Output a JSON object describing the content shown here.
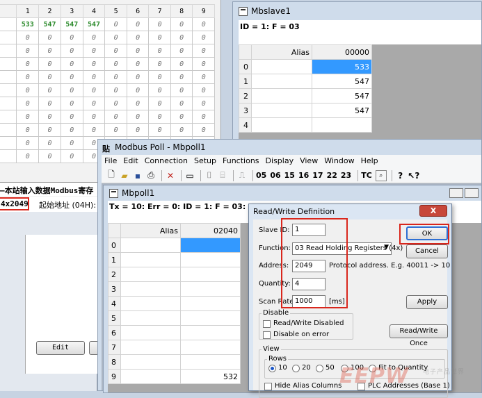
{
  "bg_grid": {
    "header": [
      "1",
      "2",
      "3",
      "4",
      "5",
      "6",
      "7",
      "8",
      "9"
    ],
    "values_row": [
      "533",
      "547",
      "547",
      "547",
      "0",
      "0",
      "0",
      "0",
      "0"
    ],
    "zero": "0",
    "title_strip": "—本站输入数据Modbus寄存",
    "address_box": "4x2049",
    "address_label": "起始地址 (04H):",
    "edit_label": "Edit"
  },
  "mbslave": {
    "title": "Mbslave1",
    "status": "ID = 1: F = 03",
    "alias_header": "Alias",
    "col_header": "00000",
    "rows": [
      {
        "n": "0",
        "value": "533"
      },
      {
        "n": "1",
        "value": "547"
      },
      {
        "n": "2",
        "value": "547"
      },
      {
        "n": "3",
        "value": "547"
      },
      {
        "n": "4",
        "value": ""
      }
    ]
  },
  "mbpoll": {
    "title": "Modbus Poll - Mbpoll1",
    "icon_text": "贴",
    "menu": [
      "File",
      "Edit",
      "Connection",
      "Setup",
      "Functions",
      "Display",
      "View",
      "Window",
      "Help"
    ],
    "toolbar_codes": [
      "05",
      "06",
      "15",
      "16",
      "17",
      "22",
      "23",
      "TC"
    ],
    "child": {
      "title": "Mbpoll1",
      "status": "Tx = 10: Err = 0: ID = 1: F = 03: SR = 1000",
      "alias_header": "Alias",
      "col_header": "02040",
      "rows": [
        "0",
        "1",
        "2",
        "3",
        "4",
        "5",
        "6",
        "7",
        "8",
        "9"
      ],
      "row9_value": "532"
    }
  },
  "dialog": {
    "title": "Read/Write Definition",
    "close": "X",
    "slave_id_label": "Slave ID:",
    "slave_id_value": "1",
    "function_label": "Function:",
    "function_value": "03 Read Holding Registers (4x)",
    "address_label": "Address:",
    "address_value": "2049",
    "address_hint": "Protocol address. E.g. 40011 -> 10",
    "quantity_label": "Quantity:",
    "quantity_value": "4",
    "scan_label": "Scan Rate:",
    "scan_value": "1000",
    "scan_unit": "[ms]",
    "ok": "OK",
    "cancel": "Cancel",
    "apply": "Apply",
    "disable_group": "Disable",
    "rw_disabled": "Read/Write Disabled",
    "disable_on_error": "Disable on error",
    "rw_once": "Read/Write Once",
    "view_group": "View",
    "rows_group": "Rows",
    "rows_options": [
      "10",
      "20",
      "50",
      "100",
      "Fit to Quantity"
    ],
    "rows_selected": "10",
    "hide_alias": "Hide Alias Columns",
    "plc_addresses": "PLC Addresses (Base 1)"
  },
  "watermark": {
    "big": "EEPW",
    "small": "电子产品世界"
  },
  "colors": {
    "highlight_red": "#d9261c",
    "selection_blue": "#3399ff",
    "value_green": "#2b8a2b"
  }
}
